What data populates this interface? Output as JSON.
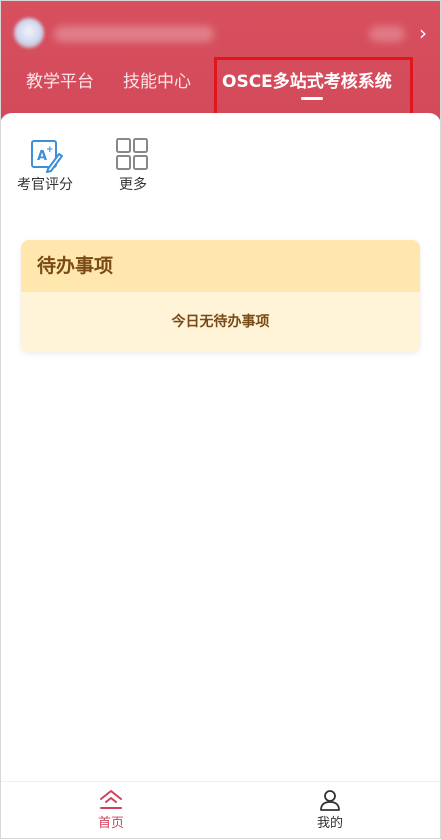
{
  "header": {
    "tabs": [
      {
        "label": "教学平台"
      },
      {
        "label": "技能中心"
      },
      {
        "label": "OSCE多站式考核系统",
        "active": true
      }
    ],
    "chevron": "›"
  },
  "apps": [
    {
      "label": "考官评分",
      "icon": "exam-scoring-icon"
    },
    {
      "label": "更多",
      "icon": "more-grid-icon"
    }
  ],
  "todo": {
    "title": "待办事项",
    "message": "今日无待办事项"
  },
  "tabbar": {
    "items": [
      {
        "label": "首页",
        "icon": "home-icon",
        "active": true
      },
      {
        "label": "我的",
        "icon": "user-icon"
      }
    ]
  },
  "colors": {
    "header_red": "#d24a5a",
    "highlight_border": "#e0161c",
    "todo_header_bg": "#ffe7ad",
    "todo_body_bg": "#fff4d8",
    "todo_text": "#7a4a16",
    "active_tab_color": "#d0425a",
    "icon_blue": "#3d8fd6"
  }
}
